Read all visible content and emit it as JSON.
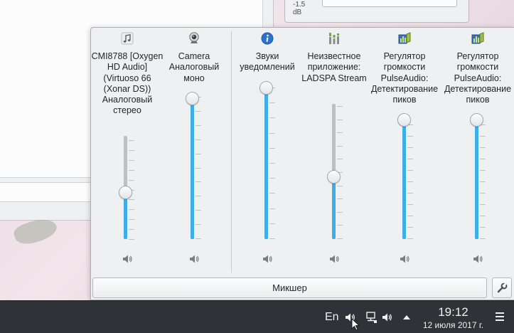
{
  "background": {
    "dialog_label": "-1.5\ndB"
  },
  "channels": [
    {
      "id": "cmi8788",
      "icon": "music-note-icon",
      "name": "CMI8788 [Oxygen HD Audio] (Virtuoso 66 (Xonar DS)) Аналоговый стерео",
      "volume_fraction": 0.44,
      "muted": false
    },
    {
      "id": "camera",
      "icon": "webcam-icon",
      "name": "Camera Аналоговый моно",
      "volume_fraction": 1.0,
      "muted": false
    },
    {
      "id": "notifications",
      "icon": "info-icon",
      "name": "Звуки уведомлений",
      "volume_fraction": 1.0,
      "muted": false
    },
    {
      "id": "ladspa",
      "icon": "equalizer-icon",
      "name": "Неизвестное приложение: LADSPA Stream",
      "volume_fraction": 0.52,
      "muted": false
    },
    {
      "id": "peak1",
      "icon": "peak-meter-icon",
      "name": "Регулятор громкости PulseAudio: Детектирование пиков",
      "volume_fraction": 1.0,
      "muted": false
    },
    {
      "id": "peak2",
      "icon": "peak-meter-icon",
      "name": "Регулятор громкости PulseAudio: Детектирование пиков",
      "volume_fraction": 1.0,
      "muted": false
    }
  ],
  "buttons": {
    "mixer_label": "Микшер",
    "configure_icon": "wrench-icon"
  },
  "taskbar": {
    "language": "En",
    "time": "19:12",
    "date": "12 июля 2017 г."
  },
  "colors": {
    "accent": "#3daee9",
    "taskbar_bg": "#2f3236"
  }
}
